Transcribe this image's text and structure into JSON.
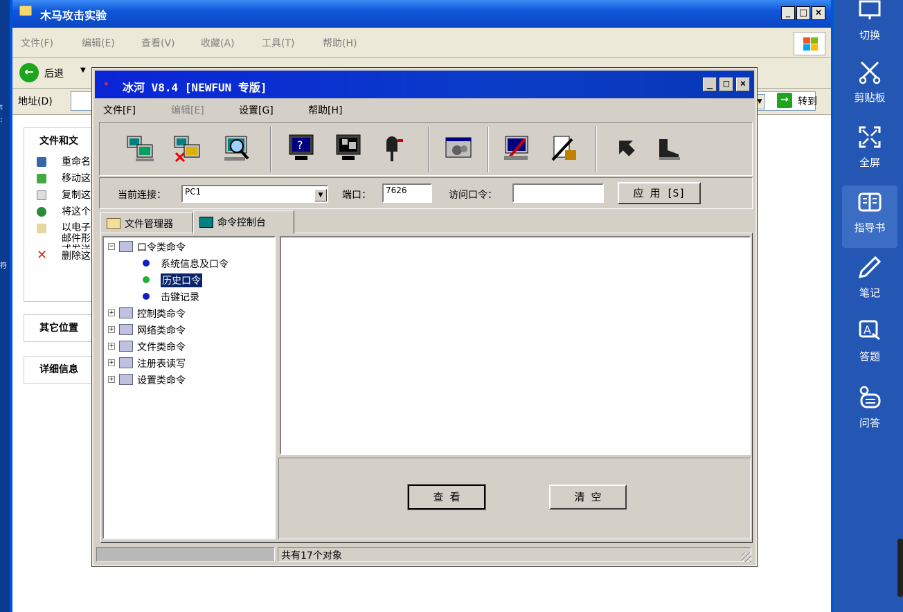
{
  "outer": {
    "title": "木马攻击实验",
    "menu": [
      "文件(F)",
      "编辑(E)",
      "查看(V)",
      "收藏(A)",
      "工具(T)",
      "帮助(H)"
    ],
    "back_label": "后退",
    "address_label": "地址(D)",
    "go_label": "转到"
  },
  "task_pane": {
    "file_section_title": "文件和文",
    "file_items": [
      "重命名",
      "移动这",
      "复制这",
      "将这个",
      "以电子邮件形式发送此文件",
      "删除这"
    ],
    "other_title": "其它位置",
    "details_title": "详细信息"
  },
  "inner": {
    "title": "冰河 V8.4 [NEWFUN 专版]",
    "menu": [
      "文件[F]",
      "编辑[E]",
      "设置[G]",
      "帮助[H]"
    ],
    "current_conn_label": "当前连接：",
    "current_conn_value": "PC1",
    "port_label": "端口：",
    "port_value": "7626",
    "password_label": "访问口令：",
    "password_value": "",
    "apply_label": "应 用 [S]",
    "tabs": [
      "文件管理器",
      "命令控制台"
    ],
    "tree": {
      "groups": [
        "口令类命令",
        "控制类命令",
        "网络类命令",
        "文件类命令",
        "注册表读写",
        "设置类命令"
      ],
      "children": [
        "系统信息及口令",
        "历史口令",
        "击键记录"
      ]
    },
    "view_label": "查 看",
    "clear_label": "清 空",
    "status_text": "共有17个对象"
  },
  "sidebar": {
    "items": [
      "切换",
      "剪贴板",
      "全屏",
      "指导书",
      "笔记",
      "答题",
      "问答"
    ]
  }
}
